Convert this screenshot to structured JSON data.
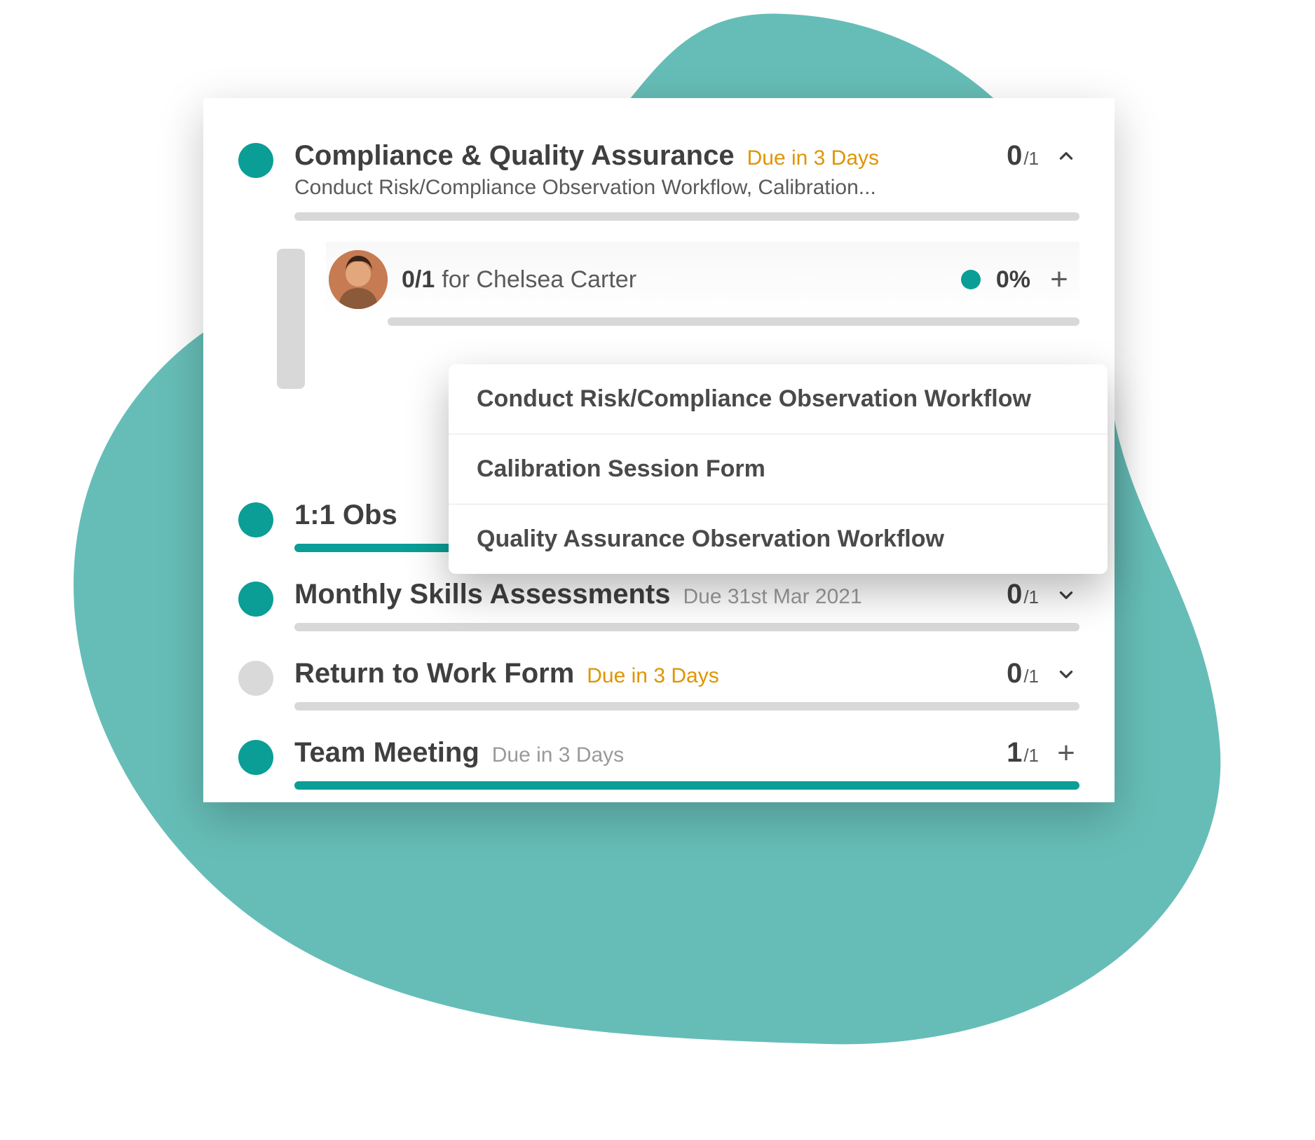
{
  "colors": {
    "teal": "#0a9e96",
    "orange": "#e09400",
    "grey": "#9a9a9a"
  },
  "items": [
    {
      "title": "Compliance & Quality Assurance",
      "due": "Due in 3 Days",
      "due_style": "orange",
      "subtitle": "Conduct Risk/Compliance Observation Workflow, Calibration...",
      "count_num": "0",
      "count_den": "/1",
      "action": "chevron-up",
      "dot": "teal",
      "progress_pct": 0,
      "expanded": {
        "person_count": "0/1",
        "person_for": "for Chelsea Carter",
        "percent": "0%",
        "progress_pct": 0
      }
    },
    {
      "title": "1:1 Obs",
      "due": "",
      "due_style": "",
      "subtitle": "",
      "count_num": "",
      "count_den": "",
      "action": "",
      "dot": "teal",
      "progress_pct": 100
    },
    {
      "title": "Monthly Skills Assessments",
      "due": "Due 31st Mar 2021",
      "due_style": "grey",
      "subtitle": "",
      "count_num": "0",
      "count_den": "/1",
      "action": "chevron-down",
      "dot": "teal",
      "progress_pct": 0
    },
    {
      "title": "Return to Work Form",
      "due": "Due in 3 Days",
      "due_style": "orange",
      "subtitle": "",
      "count_num": "0",
      "count_den": "/1",
      "action": "chevron-down",
      "dot": "grey",
      "progress_pct": 0
    },
    {
      "title": "Team Meeting",
      "due": "Due in 3 Days",
      "due_style": "grey",
      "subtitle": "",
      "count_num": "1",
      "count_den": "/1",
      "action": "plus",
      "dot": "teal",
      "progress_pct": 100
    }
  ],
  "popover": [
    "Conduct Risk/Compliance Observation Workflow",
    "Calibration Session Form",
    "Quality Assurance Observation Workflow"
  ]
}
